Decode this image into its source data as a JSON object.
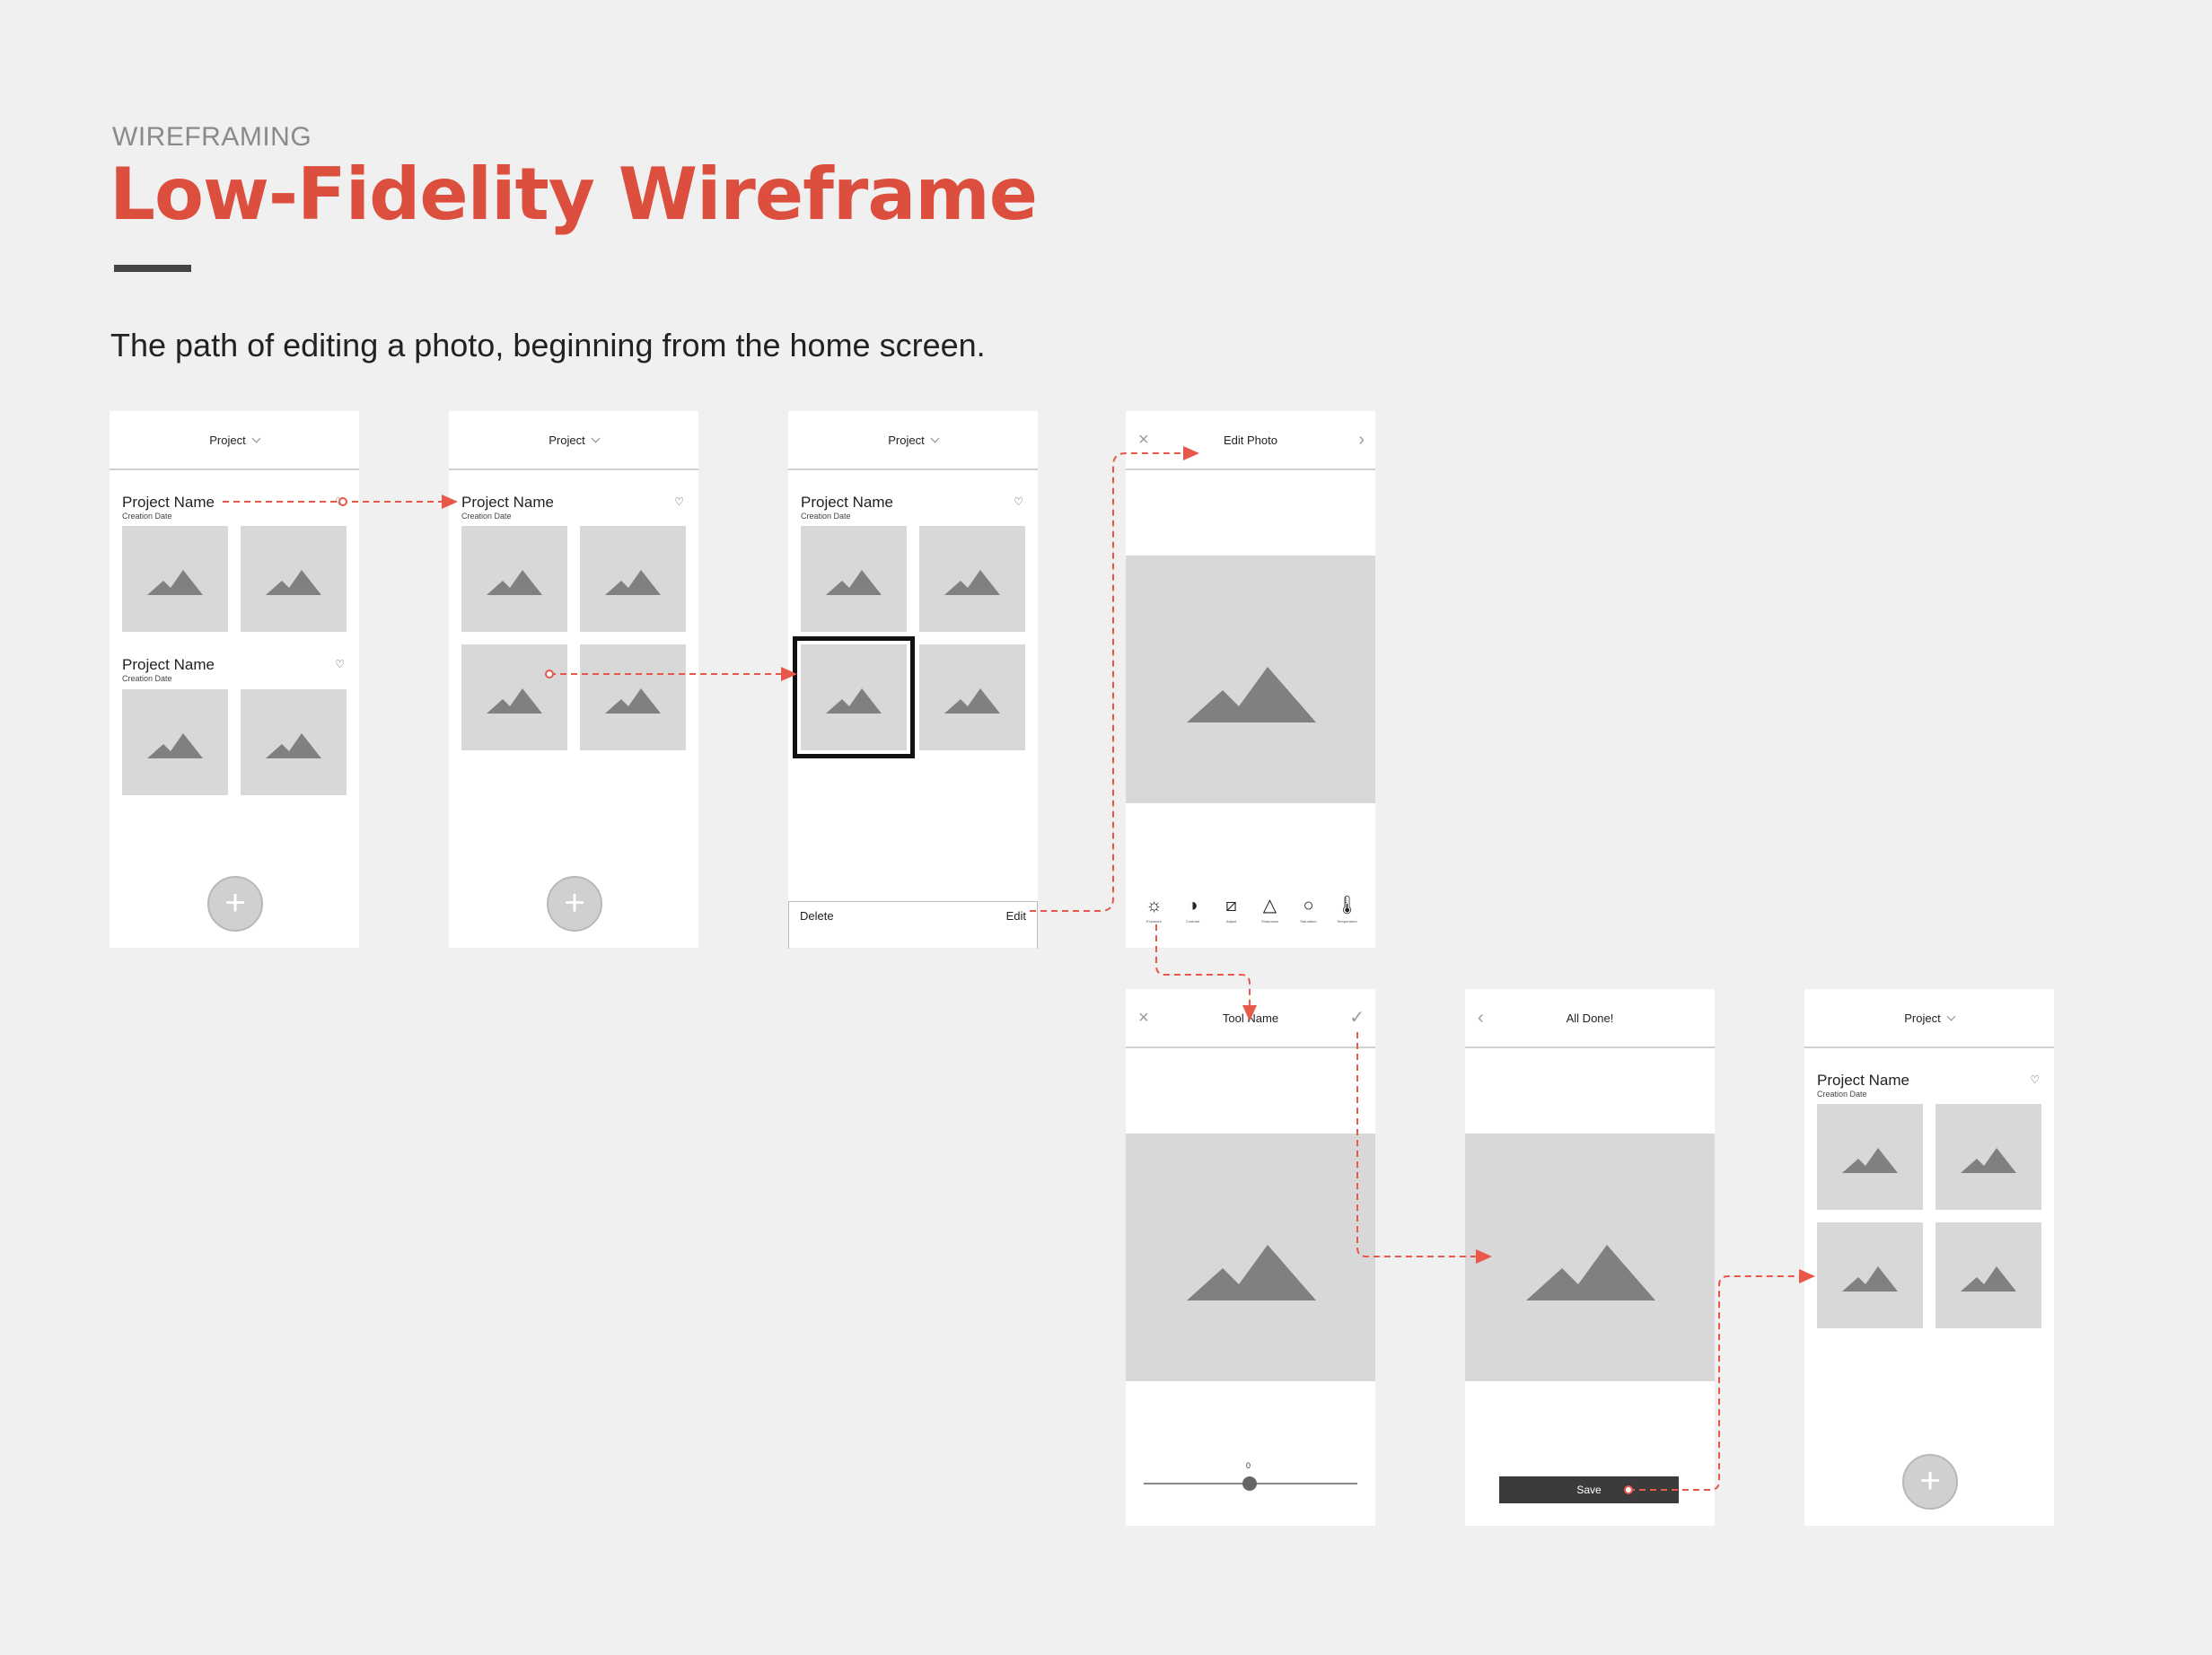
{
  "header": {
    "eyebrow": "WIREFRAMING",
    "title": "Low-Fidelity Wireframe",
    "subtitle": "The path of editing a photo, beginning from the home screen."
  },
  "accent_color": "#dc4f3f",
  "screens": {
    "home": {
      "header": "Project",
      "projects": [
        {
          "name": "Project Name",
          "date": "Creation Date"
        },
        {
          "name": "Project Name",
          "date": "Creation Date"
        }
      ],
      "fab": "+"
    },
    "project": {
      "header": "Project",
      "name": "Project Name",
      "date": "Creation Date",
      "fab": "+"
    },
    "selected": {
      "header": "Project",
      "name": "Project Name",
      "date": "Creation Date",
      "delete_label": "Delete",
      "edit_label": "Edit"
    },
    "edit_photo": {
      "header": "Edit Photo",
      "close_icon": "×",
      "next_icon": "›",
      "tools": [
        {
          "icon": "☼",
          "label": "Exposure"
        },
        {
          "icon": "◑",
          "label": "Contrast"
        },
        {
          "icon": "⧄",
          "label": "Adjust"
        },
        {
          "icon": "△",
          "label": "Sharpness"
        },
        {
          "icon": "○",
          "label": "Saturation"
        },
        {
          "icon": "🌡",
          "label": "Temperature"
        }
      ]
    },
    "tool": {
      "header": "Tool Name",
      "close_icon": "×",
      "check_icon": "✓",
      "slider_value": "0"
    },
    "done": {
      "header": "All Done!",
      "back_icon": "‹",
      "save_label": "Save"
    },
    "final": {
      "header": "Project",
      "name": "Project Name",
      "date": "Creation Date",
      "fab": "+"
    }
  }
}
